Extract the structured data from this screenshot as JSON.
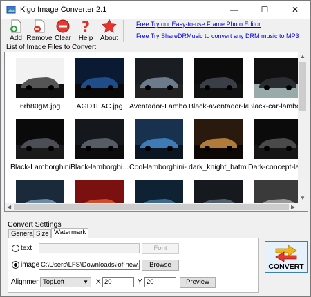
{
  "window": {
    "title": "Kigo Image Converter 2.1"
  },
  "toolbar": {
    "add_label": "Add",
    "remove_label": "Remove",
    "clear_label": "Clear",
    "help_label": "Help",
    "about_label": "About"
  },
  "links": {
    "photo_editor": "Free Try our Easy-to-use Frame Photo Editor",
    "drm_music": "Free Try ShareDRMusic to convert any DRM music to MP3"
  },
  "file_list": {
    "group_title": "List of Image Files to Convert",
    "items": [
      {
        "caption": "6rh80gM.jpg",
        "icon": "car-photo"
      },
      {
        "caption": "AGD1EAC.jpg",
        "icon": "car-photo"
      },
      {
        "caption": "Aventador-Lambo...",
        "icon": "car-photo"
      },
      {
        "caption": "Black-aventador-la...",
        "icon": "car-photo"
      },
      {
        "caption": "Black-car-lamborg...",
        "icon": "car-photo"
      },
      {
        "caption": "Black-Lamborghini-...",
        "icon": "car-photo"
      },
      {
        "caption": "Black-lamborghi...",
        "icon": "car-photo"
      },
      {
        "caption": "Cool-lamborghini-...",
        "icon": "car-photo"
      },
      {
        "caption": "dark_knight_batm...",
        "icon": "car-photo"
      },
      {
        "caption": "Dark-concept-lam...",
        "icon": "car-photo"
      },
      {
        "caption": "",
        "icon": "car-photo"
      },
      {
        "caption": "",
        "icon": "car-photo"
      },
      {
        "caption": "",
        "icon": "car-photo"
      },
      {
        "caption": "",
        "icon": "car-photo"
      },
      {
        "caption": "",
        "icon": "car-photo"
      }
    ]
  },
  "settings": {
    "group_title": "Convert Settings",
    "tabs": [
      "General",
      "Size",
      "Watermark"
    ],
    "active_tab": "Watermark",
    "text_option_label": "text",
    "text_value": "",
    "font_button": "Font",
    "image_option_label": "image",
    "image_path": "C:\\Users\\LFS\\Downloads\\lof-new.png",
    "browse_button": "Browse",
    "alignment_label": "Alignment",
    "alignment_value": "TopLeft",
    "x_label": "X",
    "x_value": "20",
    "y_label": "Y",
    "y_value": "20",
    "preview_button": "Preview",
    "selected_option": "image"
  },
  "convert_button": "CONVERT"
}
